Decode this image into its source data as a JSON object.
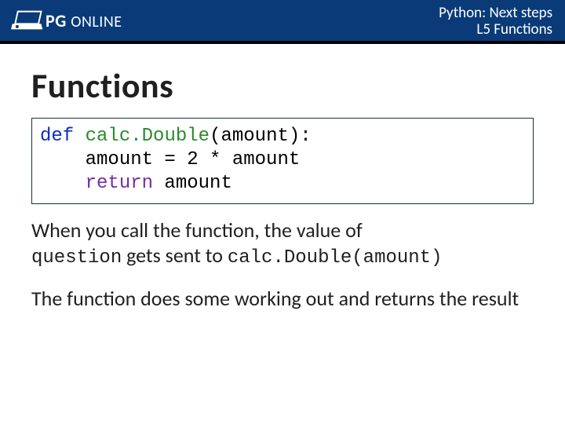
{
  "header": {
    "brand_pg": "PG",
    "brand_online": "ONLINE",
    "breadcrumb_line1": "Python: Next steps",
    "breadcrumb_line2": "L5 Functions"
  },
  "slide": {
    "title": "Functions",
    "code": {
      "def_kw": "def",
      "space1": " ",
      "fn_name": "calc.Double",
      "args_tail": "(amount):",
      "line2": "    amount = 2 * amount",
      "return_indent": "    ",
      "return_kw": "return",
      "return_tail": " amount"
    },
    "para1": {
      "lead": "When you call the function, the value of ",
      "mono1": "question",
      "mid": " gets sent to ",
      "mono2": "calc.Double(amount)"
    },
    "para2": "The function does some working out and returns the result"
  }
}
